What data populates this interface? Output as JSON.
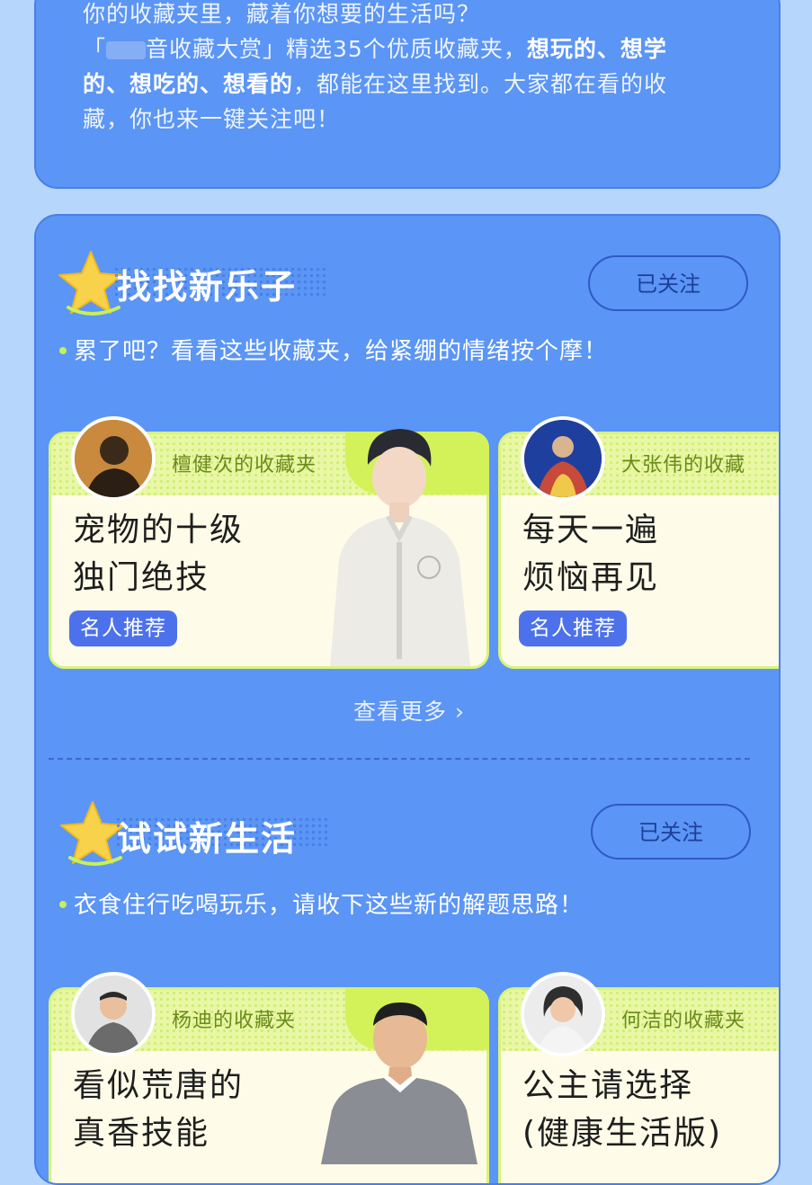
{
  "intro": {
    "line1": "你的收藏夹里，藏着你想要的生活吗？",
    "line2_prefix": "「",
    "line2_rest": "音收藏大赏」精选35个优质收藏夹，",
    "line2_bold": "想玩的、想学",
    "line3_bold": "的、想吃的、想看的",
    "line3_rest": "，都能在这里找到。大家都在看的收",
    "line4": "藏，你也来一键关注吧！"
  },
  "sections": [
    {
      "title": "找找新乐子",
      "follow_label": "已关注",
      "subtitle": "累了吧？看看这些收藏夹，给紧绷的情绪按个摩！",
      "cards": [
        {
          "owner": "檀健次的收藏夹",
          "title_line1": "宠物的十级",
          "title_line2": "独门绝技",
          "tag": "名人推荐"
        },
        {
          "owner": "大张伟的收藏",
          "title_line1": "每天一遍",
          "title_line2": "烦恼再见",
          "tag": "名人推荐"
        }
      ],
      "more_label": "查看更多 ›"
    },
    {
      "title": "试试新生活",
      "follow_label": "已关注",
      "subtitle": "衣食住行吃喝玩乐，请收下这些新的解题思路！",
      "cards": [
        {
          "owner": "杨迪的收藏夹",
          "title_line1": "看似荒唐的",
          "title_line2": "真香技能"
        },
        {
          "owner": "何洁的收藏夹",
          "title_line1": "公主请选择",
          "title_line2": "(健康生活版)"
        }
      ]
    }
  ],
  "colors": {
    "page_bg": "#b7d6fb",
    "panel_bg": "#5b95f5",
    "card_bg": "#fefce8",
    "accent_lime": "#d3f25a",
    "tag_blue": "#4c71ea"
  }
}
